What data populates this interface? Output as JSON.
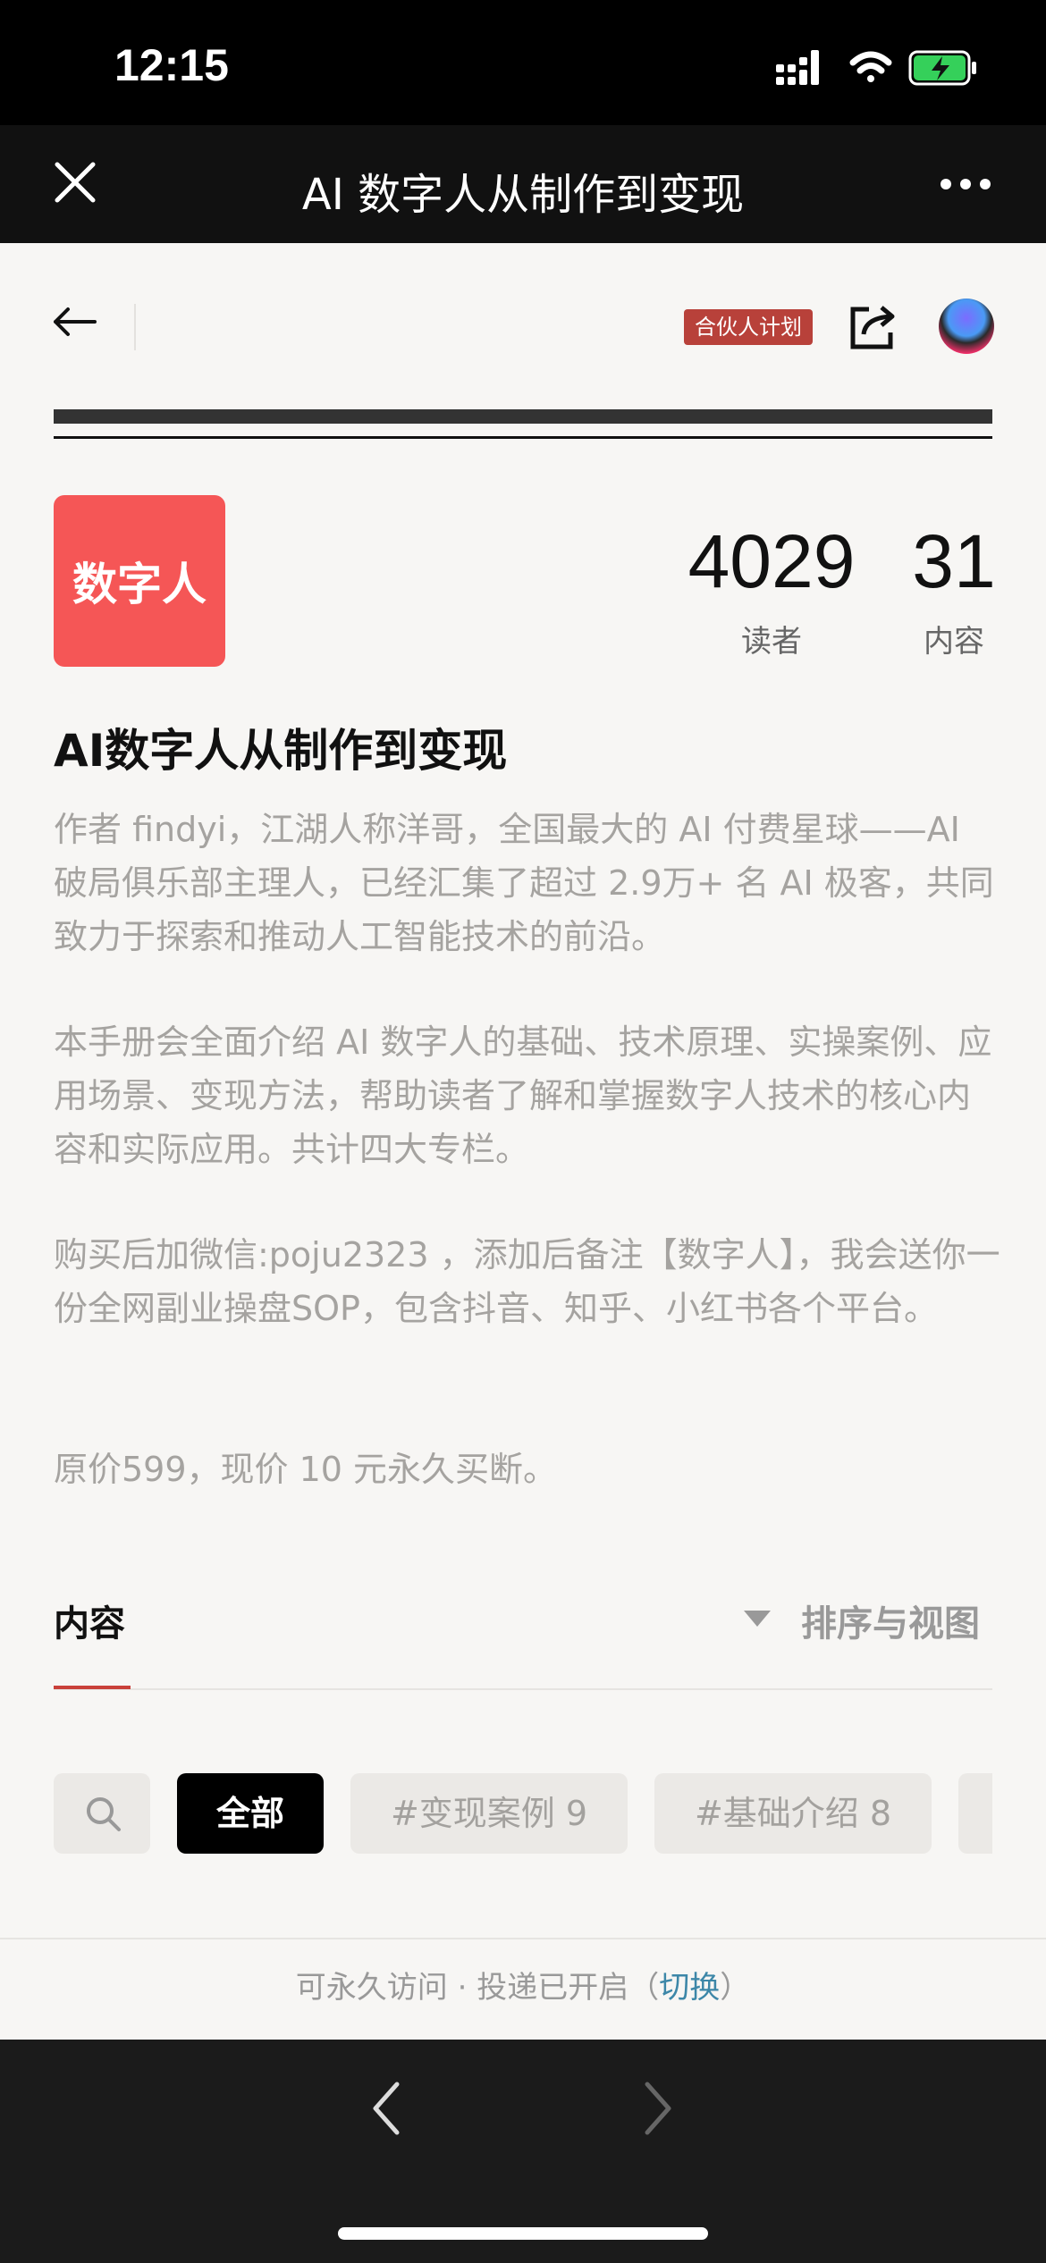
{
  "status": {
    "time": "12:15"
  },
  "browser": {
    "title": "AI 数字人从制作到变现"
  },
  "header": {
    "partner_badge": "合伙人计划"
  },
  "column": {
    "cover_text": "数字人",
    "readers_count": "4029",
    "readers_label": "读者",
    "content_count": "31",
    "content_label": "内容",
    "title": "AI数字人从制作到变现",
    "description": [
      "作者 findyi，江湖人称洋哥，全国最大的 AI 付费星球——AI 破局俱乐部主理人，已经汇集了超过 2.9万+ 名 AI 极客，共同致力于探索和推动人工智能技术的前沿。",
      "本手册会全面介绍 AI 数字人的基础、技术原理、实操案例、应用场景、变现方法，帮助读者了解和掌握数字人技术的核心内容和实际应用。共计四大专栏。",
      "购买后加微信:poju2323 ，添加后备注【数字人】，我会送你一份全网副业操盘SOP，包含抖音、知乎、小红书各个平台。",
      "原价599，现价 10 元永久买断。"
    ]
  },
  "tabs": {
    "content_label": "内容",
    "sort_label": "排序与视图"
  },
  "filters": {
    "all_label": "全部",
    "tag1_label": "#变现案例 9",
    "tag2_label": "#基础介绍 8"
  },
  "footer": {
    "note_prefix": "可永久访问 · 投递已开启（",
    "switch_label": "切换",
    "note_suffix": "）"
  },
  "colors": {
    "accent": "#c9413a",
    "cover_bg": "#f55656",
    "badge_bg": "#b8413a",
    "link": "#3d87a8"
  },
  "icons": [
    "close-icon",
    "more-icon",
    "back-arrow-icon",
    "share-icon",
    "search-icon",
    "sort-caret-icon",
    "nav-back-icon",
    "nav-forward-icon",
    "signal-icon",
    "wifi-icon",
    "battery-icon"
  ]
}
